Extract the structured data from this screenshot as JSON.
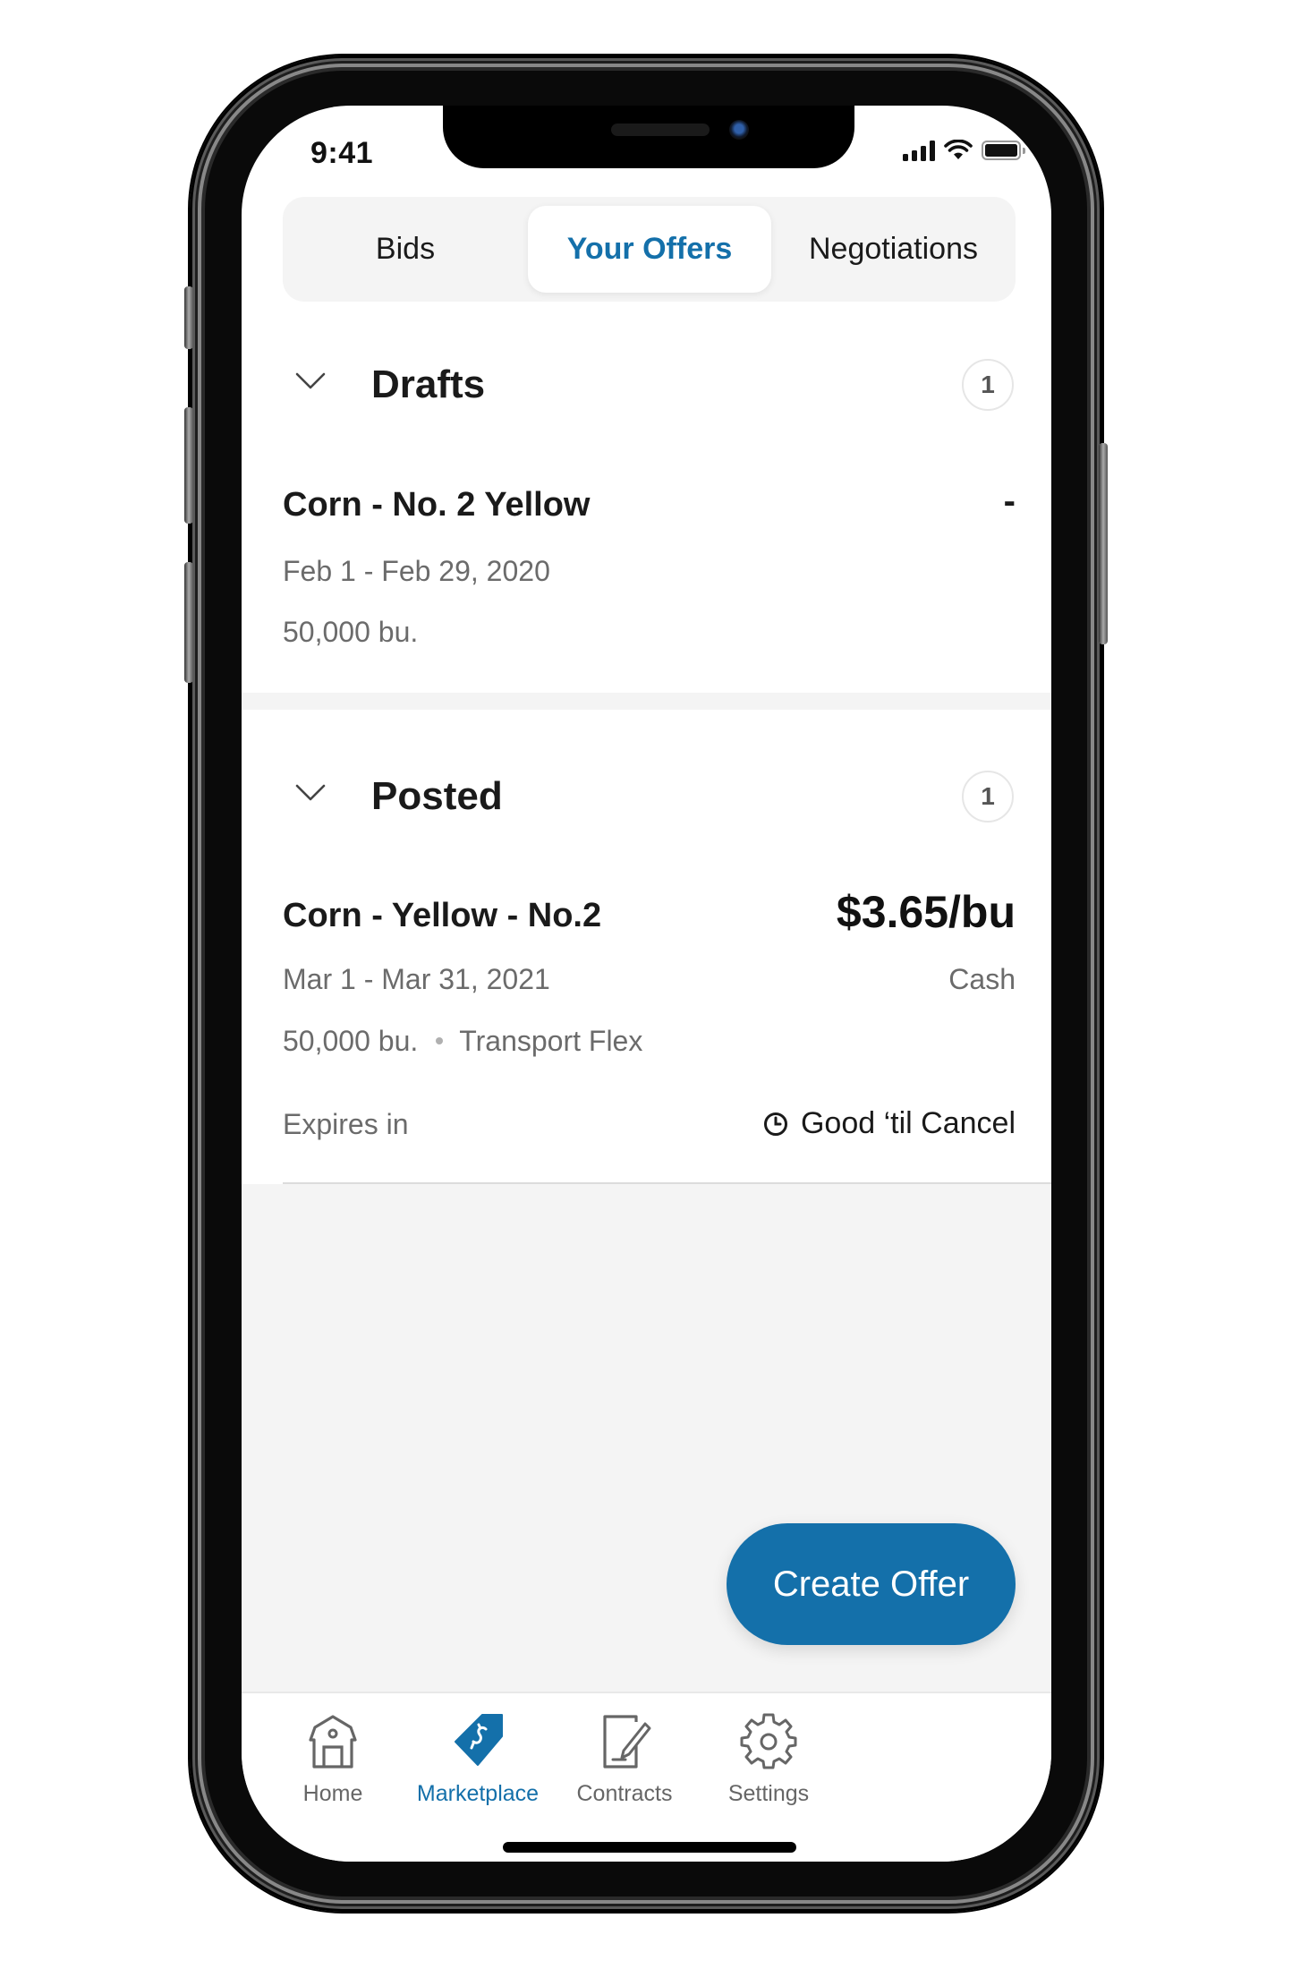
{
  "status_bar": {
    "time": "9:41",
    "icons": [
      "cellular-signal-icon",
      "wifi-icon",
      "battery-icon"
    ]
  },
  "segmented_control": {
    "tabs": [
      {
        "label": "Bids",
        "active": false
      },
      {
        "label": "Your Offers",
        "active": true
      },
      {
        "label": "Negotiations",
        "active": false
      }
    ]
  },
  "sections": {
    "drafts": {
      "title": "Drafts",
      "count": "1",
      "expanded": true,
      "items": [
        {
          "title": "Corn - No. 2 Yellow",
          "price": "-",
          "dates": "Feb 1 - Feb 29, 2020",
          "quantity": "50,000 bu."
        }
      ]
    },
    "posted": {
      "title": "Posted",
      "count": "1",
      "expanded": true,
      "items": [
        {
          "title": "Corn - Yellow - No.2",
          "price": "$3.65/bu",
          "dates": "Mar 1 - Mar 31, 2021",
          "price_type": "Cash",
          "quantity": "50,000 bu.",
          "transport": "Transport Flex",
          "expires_label": "Expires in",
          "expires_value": "Good ‘til Cancel"
        }
      ]
    }
  },
  "actions": {
    "create_offer_label": "Create Offer"
  },
  "tab_bar": {
    "items": [
      {
        "label": "Home",
        "icon": "barn-icon",
        "active": false
      },
      {
        "label": "Marketplace",
        "icon": "price-tag-icon",
        "active": true
      },
      {
        "label": "Contracts",
        "icon": "contract-sign-icon",
        "active": false
      },
      {
        "label": "Settings",
        "icon": "gear-icon",
        "active": false
      }
    ]
  },
  "colors": {
    "accent": "#1470aa",
    "text_primary": "#1a1a1a",
    "text_secondary": "#6b6b6b",
    "surface_gray": "#f4f4f4"
  }
}
